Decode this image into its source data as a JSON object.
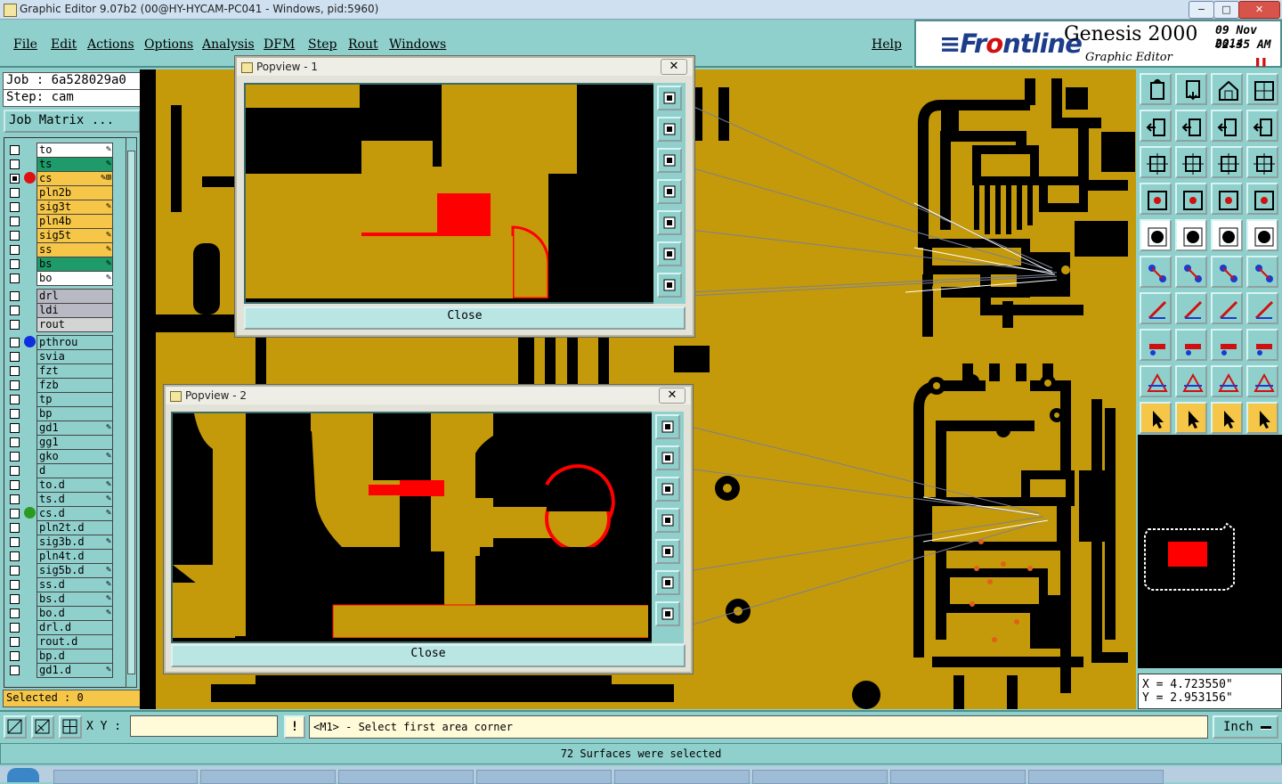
{
  "window": {
    "title": "Graphic Editor 9.07b2 (00@HY-HYCAM-PC041 - Windows, pid:5960)",
    "minimize": "−",
    "maximize": "□",
    "close": "✕"
  },
  "menu": {
    "file": "File",
    "edit": "Edit",
    "actions": "Actions",
    "options": "Options",
    "analysis": "Analysis",
    "dfm": "DFM",
    "step": "Step",
    "rout": "Rout",
    "windows": "Windows",
    "help": "Help"
  },
  "brand": {
    "logo_pre": "≡Fr",
    "logo_o": "o",
    "logo_post": "ntline",
    "product": "Genesis 2000",
    "subtitle": "Graphic Editor",
    "date": "09 Nov 2014",
    "time": "02:35 AM",
    "pause_icon": "❚❚"
  },
  "left": {
    "job": "Job : 6a528029a0",
    "step": "Step: cam",
    "job_matrix": "Job Matrix ...",
    "selected": "Selected : 0"
  },
  "layers": [
    {
      "name": "to",
      "bg": "#ffffff",
      "flag": "✎",
      "dot": ""
    },
    {
      "name": "ts",
      "bg": "#1f9a6a",
      "flag": "✎",
      "dot": ""
    },
    {
      "name": "cs",
      "bg": "#f5c648",
      "flag": "✎⊞",
      "dot": "#e01010",
      "checked": true
    },
    {
      "name": "pln2b",
      "bg": "#f5c648",
      "flag": "",
      "dot": ""
    },
    {
      "name": "sig3t",
      "bg": "#f5c648",
      "flag": "✎",
      "dot": ""
    },
    {
      "name": "pln4b",
      "bg": "#f5c648",
      "flag": "",
      "dot": ""
    },
    {
      "name": "sig5t",
      "bg": "#f5c648",
      "flag": "✎",
      "dot": ""
    },
    {
      "name": "ss",
      "bg": "#f5c648",
      "flag": "✎",
      "dot": ""
    },
    {
      "name": "bs",
      "bg": "#1f9a6a",
      "flag": "✎",
      "dot": ""
    },
    {
      "name": "bo",
      "bg": "#ffffff",
      "flag": "✎",
      "dot": ""
    },
    {
      "name": "drl",
      "bg": "#b9b9c4",
      "flag": "",
      "dot": ""
    },
    {
      "name": "ldi",
      "bg": "#b9b9c4",
      "flag": "",
      "dot": ""
    },
    {
      "name": "rout",
      "bg": "#d4d4d4",
      "flag": "",
      "dot": ""
    },
    {
      "name": "pthrou",
      "bg": "#8fd0cd",
      "flag": "",
      "dot": "#1030e0"
    },
    {
      "name": "svia",
      "bg": "#8fd0cd",
      "flag": "",
      "dot": ""
    },
    {
      "name": "fzt",
      "bg": "#8fd0cd",
      "flag": "",
      "dot": ""
    },
    {
      "name": "fzb",
      "bg": "#8fd0cd",
      "flag": "",
      "dot": ""
    },
    {
      "name": "tp",
      "bg": "#8fd0cd",
      "flag": "",
      "dot": ""
    },
    {
      "name": "bp",
      "bg": "#8fd0cd",
      "flag": "",
      "dot": ""
    },
    {
      "name": "gd1",
      "bg": "#8fd0cd",
      "flag": "✎",
      "dot": ""
    },
    {
      "name": "gg1",
      "bg": "#8fd0cd",
      "flag": "",
      "dot": ""
    },
    {
      "name": "gko",
      "bg": "#8fd0cd",
      "flag": "✎",
      "dot": ""
    },
    {
      "name": "d",
      "bg": "#8fd0cd",
      "flag": "",
      "dot": ""
    },
    {
      "name": "to.d",
      "bg": "#8fd0cd",
      "flag": "✎",
      "dot": ""
    },
    {
      "name": "ts.d",
      "bg": "#8fd0cd",
      "flag": "✎",
      "dot": ""
    },
    {
      "name": "cs.d",
      "bg": "#8fd0cd",
      "flag": "✎",
      "dot": "#2a9a20"
    },
    {
      "name": "pln2t.d",
      "bg": "#8fd0cd",
      "flag": "",
      "dot": ""
    },
    {
      "name": "sig3b.d",
      "bg": "#8fd0cd",
      "flag": "✎",
      "dot": ""
    },
    {
      "name": "pln4t.d",
      "bg": "#8fd0cd",
      "flag": "",
      "dot": ""
    },
    {
      "name": "sig5b.d",
      "bg": "#8fd0cd",
      "flag": "✎",
      "dot": ""
    },
    {
      "name": "ss.d",
      "bg": "#8fd0cd",
      "flag": "✎",
      "dot": ""
    },
    {
      "name": "bs.d",
      "bg": "#8fd0cd",
      "flag": "✎",
      "dot": ""
    },
    {
      "name": "bo.d",
      "bg": "#8fd0cd",
      "flag": "✎",
      "dot": ""
    },
    {
      "name": "drl.d",
      "bg": "#8fd0cd",
      "flag": "",
      "dot": ""
    },
    {
      "name": "rout.d",
      "bg": "#8fd0cd",
      "flag": "",
      "dot": ""
    },
    {
      "name": "bp.d",
      "bg": "#8fd0cd",
      "flag": "",
      "dot": ""
    },
    {
      "name": "gd1.d",
      "bg": "#8fd0cd",
      "flag": "✎",
      "dot": ""
    }
  ],
  "popview1": {
    "title": "Popview - 1",
    "close_x": "✕",
    "close_label": "Close"
  },
  "popview2": {
    "title": "Popview - 2",
    "close_x": "✕",
    "close_label": "Close"
  },
  "coords": {
    "x": "X = 4.723550\"",
    "y": "Y = 2.953156\""
  },
  "command": {
    "xy_label": "X Y :",
    "xy_value": "",
    "bang": "!",
    "prompt": "<M1> - Select first area corner",
    "units": "Inch"
  },
  "status": "72 Surfaces were selected",
  "tool_icons": [
    "zoom-home-icon",
    "zoom-selection-icon",
    "zoom-back-icon",
    "window-icon",
    "pan-left-icon",
    "pan-right-icon",
    "mirror-icon",
    "swap-icon",
    "zoom-fit-icon",
    "zoom-center-icon",
    "scale-1-2-icon",
    "help-query-icon",
    "snap-icon",
    "grid-icon",
    "layer-compare-icon",
    "layer-stack-icon",
    "select-point-icon",
    "select-line-icon",
    "measure-ruler-icon",
    "select-pad-icon",
    "connect-nodes-icon",
    "delete-node-icon",
    "move-pad-icon",
    "copy-pad-icon",
    "add-line-icon",
    "add-arc-icon",
    "rotate-icon",
    "split-icon",
    "add-via-icon",
    "cut-line-icon",
    "select-region-icon",
    "clone-icon",
    "polygon-add-icon",
    "polygon-edit-icon",
    "polygon-fill-icon",
    "polygon-cut-icon",
    "pointer-icon",
    "pointer-box-icon",
    "pointer-circle-icon",
    "pointer-net-icon"
  ]
}
